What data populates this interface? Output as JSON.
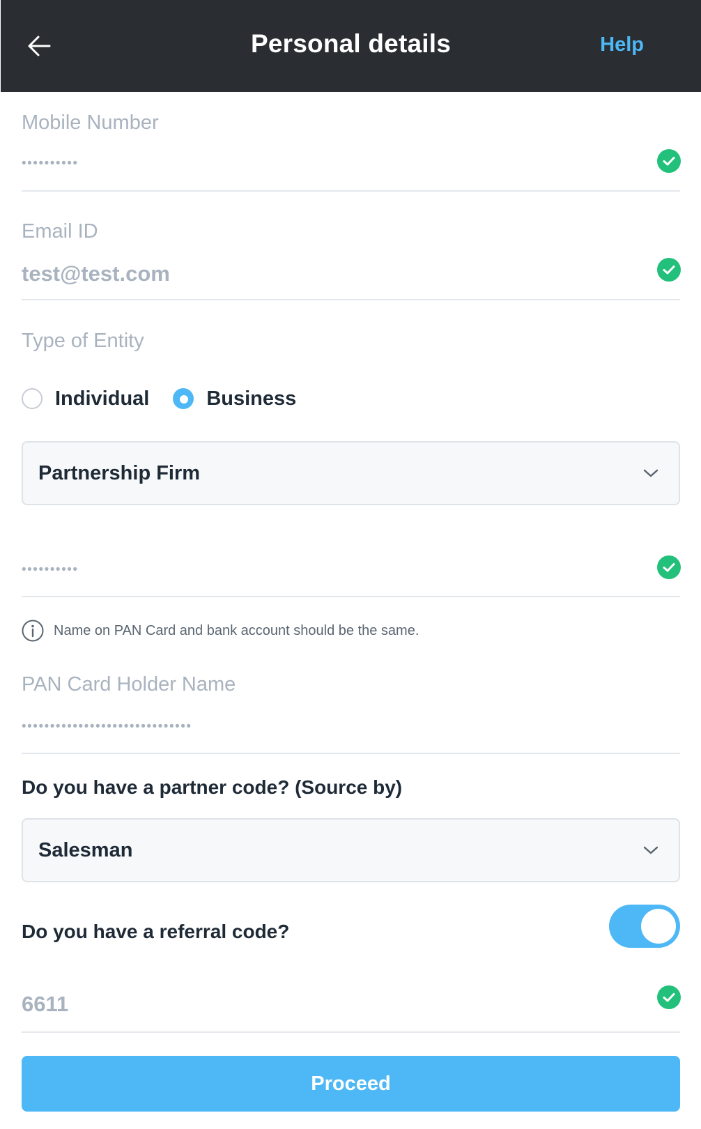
{
  "header": {
    "back_icon": "arrow-left-icon",
    "title": "Personal details",
    "help_label": "Help"
  },
  "colors": {
    "header_bg": "#2a2d31",
    "accent": "#4db8f5",
    "success": "#22c07a",
    "muted_text": "#a9b3bf"
  },
  "mobile": {
    "label": "Mobile Number",
    "value": "••••••••••",
    "verified": true
  },
  "email": {
    "label": "Email ID",
    "value": "test@test.com",
    "verified": true
  },
  "entity": {
    "label": "Type of Entity",
    "options": [
      {
        "label": "Individual",
        "selected": false
      },
      {
        "label": "Business",
        "selected": true
      }
    ],
    "business_type": "Partnership Firm"
  },
  "pan": {
    "value": "••••••••••",
    "verified": true,
    "info_icon": "info-icon",
    "info_text": "Name on PAN Card and bank account should be the same."
  },
  "pan_holder": {
    "label": "PAN Card Holder Name",
    "value": "••••••••••••••••••••••••••••••"
  },
  "partner_code": {
    "question": "Do you have a partner code? (Source by)",
    "selected": "Salesman"
  },
  "referral": {
    "question": "Do you have a referral code?",
    "enabled": true,
    "value": "6611",
    "verified": true
  },
  "proceed_label": "Proceed"
}
